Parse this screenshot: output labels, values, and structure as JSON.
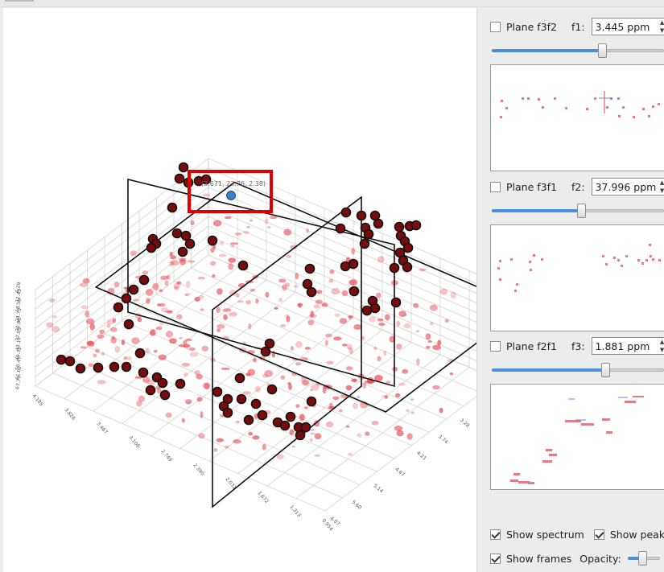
{
  "viewer": {
    "coordinate_label": "(3.671, 23.76, 2.38)",
    "axis_f2_ticks": [
      "6.29",
      "12.43",
      "18.58",
      "24.73",
      "30.88",
      "37.03",
      "43.17",
      "49.32",
      "55.47",
      "61.62",
      "67.77"
    ],
    "axis_f1_ticks": [
      "2.35",
      "2.81",
      "3.28",
      "3.74",
      "4.21",
      "4.67",
      "5.14",
      "5.60",
      "6.07"
    ],
    "axis_f3_ticks": [
      "4.185",
      "3.826",
      "3.467",
      "3.108",
      "2.749",
      "2.390",
      "2.031",
      "1.672",
      "1.313",
      "0.954"
    ]
  },
  "panel": {
    "plane1": {
      "label": "Plane f3f2",
      "checked": false,
      "axis": "f1:",
      "value": "3.445 ppm",
      "slider_pct": 0.64
    },
    "plane2": {
      "label": "Plane f3f1",
      "checked": false,
      "axis": "f2:",
      "value": "37.996 ppm",
      "slider_pct": 0.52
    },
    "plane3": {
      "label": "Plane f2f1",
      "checked": false,
      "axis": "f3:",
      "value": "1.881 ppm",
      "slider_pct": 0.66
    },
    "show_spectrum": {
      "label": "Show spectrum",
      "checked": true
    },
    "show_peaks": {
      "label": "Show peaks",
      "checked": true
    },
    "show_frames": {
      "label": "Show frames",
      "checked": true
    },
    "opacity": {
      "label": "Opacity:",
      "value_pct": 0.45
    }
  },
  "colors": {
    "peak": "#7a0b0b",
    "spectrum": "#e8434a",
    "highlight": "#e00000",
    "slider_fill": "#4a8fdc"
  }
}
